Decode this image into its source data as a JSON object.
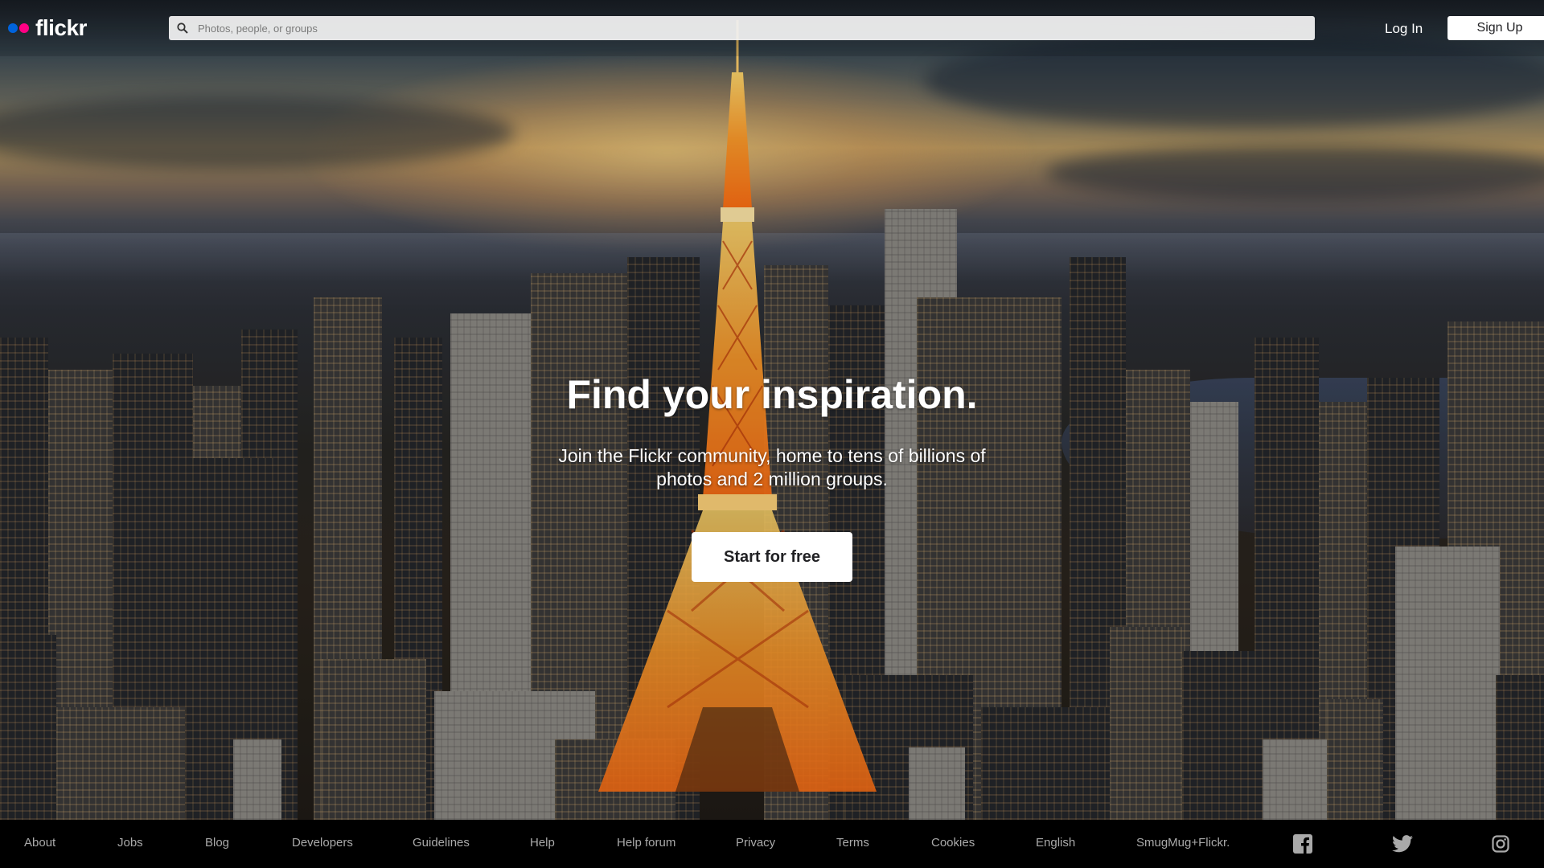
{
  "brand": {
    "name": "flickr",
    "dot_colors": [
      "#0063dc",
      "#ff0084"
    ]
  },
  "header": {
    "search_placeholder": "Photos, people, or groups",
    "search_icon": "search-icon",
    "login_label": "Log In",
    "signup_label": "Sign Up"
  },
  "hero": {
    "headline": "Find your inspiration.",
    "subline": "Join the Flickr community, home to tens of billions of photos and 2 million groups.",
    "cta_label": "Start for free"
  },
  "footer": {
    "links": [
      "About",
      "Jobs",
      "Blog",
      "Developers",
      "Guidelines",
      "Help",
      "Help forum",
      "Privacy",
      "Terms",
      "Cookies",
      "English",
      "SmugMug+Flickr."
    ],
    "social_icons": [
      "facebook-icon",
      "twitter-icon",
      "instagram-icon"
    ]
  },
  "colors": {
    "footer_bg": "#000000",
    "footer_text": "#a9a9a9",
    "button_bg": "#ffffff"
  }
}
